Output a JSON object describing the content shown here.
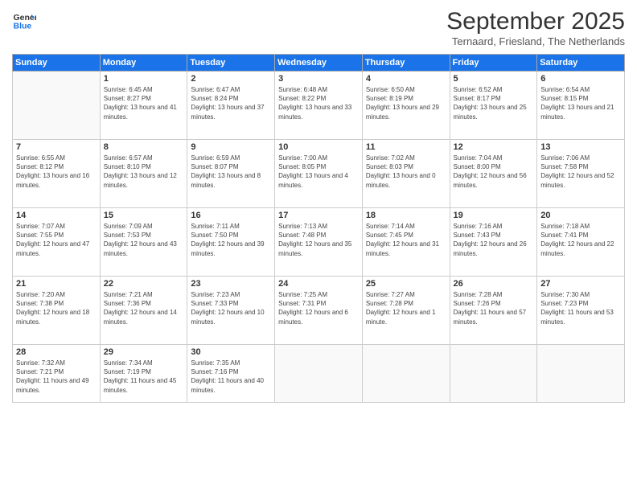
{
  "logo": {
    "general": "General",
    "blue": "Blue"
  },
  "title": "September 2025",
  "subtitle": "Ternaard, Friesland, The Netherlands",
  "days_header": [
    "Sunday",
    "Monday",
    "Tuesday",
    "Wednesday",
    "Thursday",
    "Friday",
    "Saturday"
  ],
  "weeks": [
    [
      {
        "day": "",
        "empty": true
      },
      {
        "day": "1",
        "sunrise": "Sunrise: 6:45 AM",
        "sunset": "Sunset: 8:27 PM",
        "daylight": "Daylight: 13 hours and 41 minutes."
      },
      {
        "day": "2",
        "sunrise": "Sunrise: 6:47 AM",
        "sunset": "Sunset: 8:24 PM",
        "daylight": "Daylight: 13 hours and 37 minutes."
      },
      {
        "day": "3",
        "sunrise": "Sunrise: 6:48 AM",
        "sunset": "Sunset: 8:22 PM",
        "daylight": "Daylight: 13 hours and 33 minutes."
      },
      {
        "day": "4",
        "sunrise": "Sunrise: 6:50 AM",
        "sunset": "Sunset: 8:19 PM",
        "daylight": "Daylight: 13 hours and 29 minutes."
      },
      {
        "day": "5",
        "sunrise": "Sunrise: 6:52 AM",
        "sunset": "Sunset: 8:17 PM",
        "daylight": "Daylight: 13 hours and 25 minutes."
      },
      {
        "day": "6",
        "sunrise": "Sunrise: 6:54 AM",
        "sunset": "Sunset: 8:15 PM",
        "daylight": "Daylight: 13 hours and 21 minutes."
      }
    ],
    [
      {
        "day": "7",
        "sunrise": "Sunrise: 6:55 AM",
        "sunset": "Sunset: 8:12 PM",
        "daylight": "Daylight: 13 hours and 16 minutes."
      },
      {
        "day": "8",
        "sunrise": "Sunrise: 6:57 AM",
        "sunset": "Sunset: 8:10 PM",
        "daylight": "Daylight: 13 hours and 12 minutes."
      },
      {
        "day": "9",
        "sunrise": "Sunrise: 6:59 AM",
        "sunset": "Sunset: 8:07 PM",
        "daylight": "Daylight: 13 hours and 8 minutes."
      },
      {
        "day": "10",
        "sunrise": "Sunrise: 7:00 AM",
        "sunset": "Sunset: 8:05 PM",
        "daylight": "Daylight: 13 hours and 4 minutes."
      },
      {
        "day": "11",
        "sunrise": "Sunrise: 7:02 AM",
        "sunset": "Sunset: 8:03 PM",
        "daylight": "Daylight: 13 hours and 0 minutes."
      },
      {
        "day": "12",
        "sunrise": "Sunrise: 7:04 AM",
        "sunset": "Sunset: 8:00 PM",
        "daylight": "Daylight: 12 hours and 56 minutes."
      },
      {
        "day": "13",
        "sunrise": "Sunrise: 7:06 AM",
        "sunset": "Sunset: 7:58 PM",
        "daylight": "Daylight: 12 hours and 52 minutes."
      }
    ],
    [
      {
        "day": "14",
        "sunrise": "Sunrise: 7:07 AM",
        "sunset": "Sunset: 7:55 PM",
        "daylight": "Daylight: 12 hours and 47 minutes."
      },
      {
        "day": "15",
        "sunrise": "Sunrise: 7:09 AM",
        "sunset": "Sunset: 7:53 PM",
        "daylight": "Daylight: 12 hours and 43 minutes."
      },
      {
        "day": "16",
        "sunrise": "Sunrise: 7:11 AM",
        "sunset": "Sunset: 7:50 PM",
        "daylight": "Daylight: 12 hours and 39 minutes."
      },
      {
        "day": "17",
        "sunrise": "Sunrise: 7:13 AM",
        "sunset": "Sunset: 7:48 PM",
        "daylight": "Daylight: 12 hours and 35 minutes."
      },
      {
        "day": "18",
        "sunrise": "Sunrise: 7:14 AM",
        "sunset": "Sunset: 7:45 PM",
        "daylight": "Daylight: 12 hours and 31 minutes."
      },
      {
        "day": "19",
        "sunrise": "Sunrise: 7:16 AM",
        "sunset": "Sunset: 7:43 PM",
        "daylight": "Daylight: 12 hours and 26 minutes."
      },
      {
        "day": "20",
        "sunrise": "Sunrise: 7:18 AM",
        "sunset": "Sunset: 7:41 PM",
        "daylight": "Daylight: 12 hours and 22 minutes."
      }
    ],
    [
      {
        "day": "21",
        "sunrise": "Sunrise: 7:20 AM",
        "sunset": "Sunset: 7:38 PM",
        "daylight": "Daylight: 12 hours and 18 minutes."
      },
      {
        "day": "22",
        "sunrise": "Sunrise: 7:21 AM",
        "sunset": "Sunset: 7:36 PM",
        "daylight": "Daylight: 12 hours and 14 minutes."
      },
      {
        "day": "23",
        "sunrise": "Sunrise: 7:23 AM",
        "sunset": "Sunset: 7:33 PM",
        "daylight": "Daylight: 12 hours and 10 minutes."
      },
      {
        "day": "24",
        "sunrise": "Sunrise: 7:25 AM",
        "sunset": "Sunset: 7:31 PM",
        "daylight": "Daylight: 12 hours and 6 minutes."
      },
      {
        "day": "25",
        "sunrise": "Sunrise: 7:27 AM",
        "sunset": "Sunset: 7:28 PM",
        "daylight": "Daylight: 12 hours and 1 minute."
      },
      {
        "day": "26",
        "sunrise": "Sunrise: 7:28 AM",
        "sunset": "Sunset: 7:26 PM",
        "daylight": "Daylight: 11 hours and 57 minutes."
      },
      {
        "day": "27",
        "sunrise": "Sunrise: 7:30 AM",
        "sunset": "Sunset: 7:23 PM",
        "daylight": "Daylight: 11 hours and 53 minutes."
      }
    ],
    [
      {
        "day": "28",
        "sunrise": "Sunrise: 7:32 AM",
        "sunset": "Sunset: 7:21 PM",
        "daylight": "Daylight: 11 hours and 49 minutes."
      },
      {
        "day": "29",
        "sunrise": "Sunrise: 7:34 AM",
        "sunset": "Sunset: 7:19 PM",
        "daylight": "Daylight: 11 hours and 45 minutes."
      },
      {
        "day": "30",
        "sunrise": "Sunrise: 7:35 AM",
        "sunset": "Sunset: 7:16 PM",
        "daylight": "Daylight: 11 hours and 40 minutes."
      },
      {
        "day": "",
        "empty": true
      },
      {
        "day": "",
        "empty": true
      },
      {
        "day": "",
        "empty": true
      },
      {
        "day": "",
        "empty": true
      }
    ]
  ]
}
